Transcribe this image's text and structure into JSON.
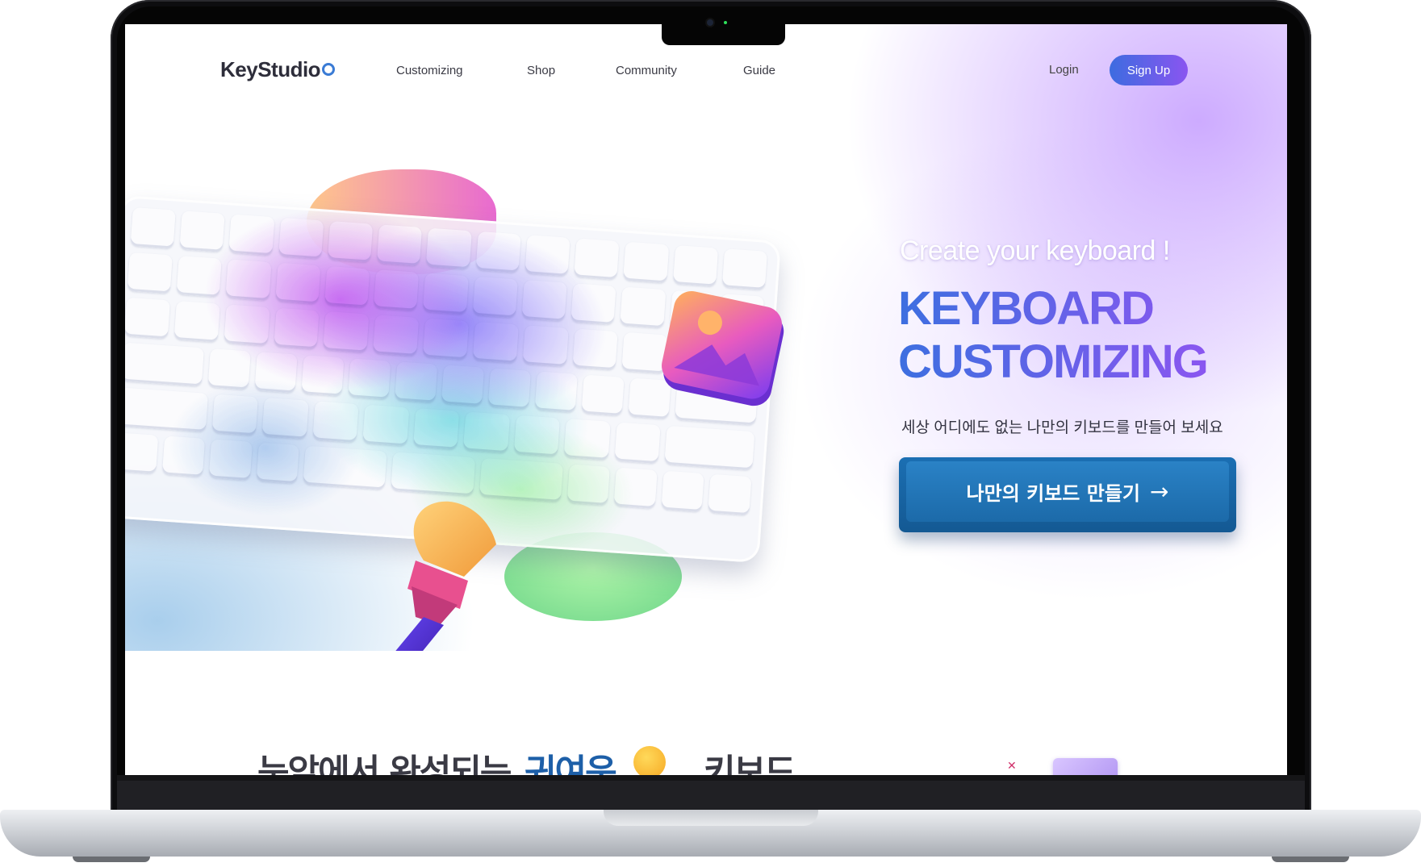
{
  "nav": {
    "logo": "KeyStudio",
    "links": [
      "Customizing",
      "Shop",
      "Community",
      "Guide"
    ],
    "login": "Login",
    "signup": "Sign Up"
  },
  "hero": {
    "eyebrow": "Create your keyboard !",
    "title_line1": "KEYBOARD",
    "title_line2": "CUSTOMIZING",
    "subtitle": "세상 어디에도 없는 나만의 키보드를 만들어 보세요",
    "cta": "나만의 키보드 만들기",
    "cta_arrow": "→"
  },
  "section2": {
    "title_left": "눈앞에서 완성되는",
    "title_highlight": "귀여운",
    "title_right": "키보드"
  },
  "colors": {
    "accent_blue": "#3d6ce0",
    "accent_purple": "#8a55f0",
    "cta_blue": "#1c6aa9",
    "highlight_blue": "#1d5fa8"
  },
  "icons": {
    "cta": "arrow-right-icon",
    "illustration_photo": "image-icon",
    "illustration_brush": "paintbrush-icon",
    "emoji": "kissing-face-emoji"
  }
}
